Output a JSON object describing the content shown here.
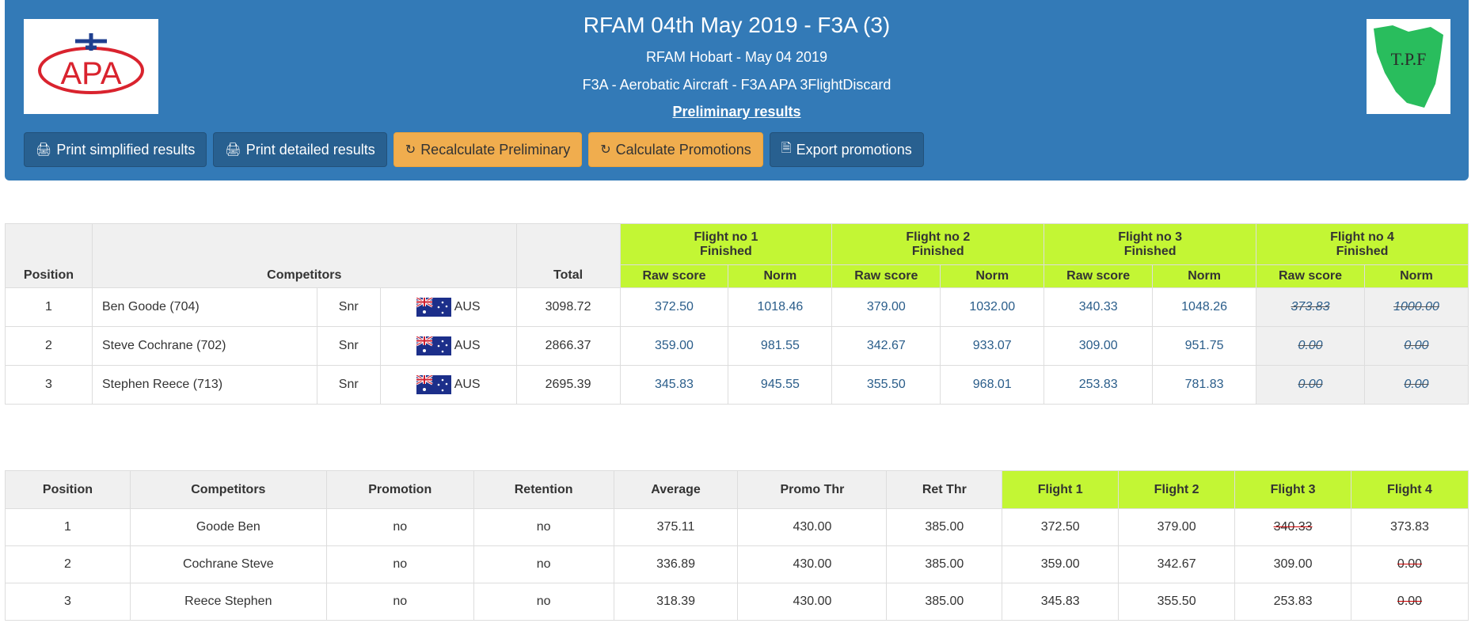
{
  "header": {
    "title": "RFAM 04th May 2019 - F3A (3)",
    "subtitle": "RFAM Hobart - May 04 2019",
    "class_line": "F3A - Aerobatic Aircraft - F3A APA 3FlightDiscard",
    "status": "Preliminary results",
    "logo_left_text": "APA",
    "logo_right_text": "T.P.F",
    "colors": {
      "bar": "#337ab7",
      "button_dark": "#286090",
      "button_warn": "#f0ad4e",
      "flight_header": "#c3f634"
    }
  },
  "buttons": [
    {
      "label": "Print simplified results",
      "icon": "print-icon",
      "style": "dark"
    },
    {
      "label": "Print detailed results",
      "icon": "print-icon",
      "style": "dark"
    },
    {
      "label": "Recalculate Preliminary",
      "icon": "refresh-icon",
      "style": "warn"
    },
    {
      "label": "Calculate Promotions",
      "icon": "refresh-icon",
      "style": "warn"
    },
    {
      "label": "Export promotions",
      "icon": "excel-file-icon",
      "style": "dark"
    }
  ],
  "results": {
    "headers": {
      "position": "Position",
      "competitors": "Competitors",
      "total": "Total",
      "flights": [
        {
          "title": "Flight no 1",
          "status": "Finished"
        },
        {
          "title": "Flight no 2",
          "status": "Finished"
        },
        {
          "title": "Flight no 3",
          "status": "Finished"
        },
        {
          "title": "Flight no 4",
          "status": "Finished"
        }
      ],
      "raw": "Raw score",
      "norm": "Norm"
    },
    "rows": [
      {
        "position": "1",
        "name": "Ben Goode (704)",
        "class": "Snr",
        "country": "AUS",
        "total": "3098.72",
        "scores": [
          [
            "372.50",
            "1018.46"
          ],
          [
            "379.00",
            "1032.00"
          ],
          [
            "340.33",
            "1048.26"
          ],
          [
            "373.83",
            "1000.00"
          ]
        ]
      },
      {
        "position": "2",
        "name": "Steve Cochrane (702)",
        "class": "Snr",
        "country": "AUS",
        "total": "2866.37",
        "scores": [
          [
            "359.00",
            "981.55"
          ],
          [
            "342.67",
            "933.07"
          ],
          [
            "309.00",
            "951.75"
          ],
          [
            "0.00",
            "0.00"
          ]
        ]
      },
      {
        "position": "3",
        "name": "Stephen Reece (713)",
        "class": "Snr",
        "country": "AUS",
        "total": "2695.39",
        "scores": [
          [
            "345.83",
            "945.55"
          ],
          [
            "355.50",
            "968.01"
          ],
          [
            "253.83",
            "781.83"
          ],
          [
            "0.00",
            "0.00"
          ]
        ]
      }
    ]
  },
  "promotions": {
    "headers": [
      "Position",
      "Competitors",
      "Promotion",
      "Retention",
      "Average",
      "Promo Thr",
      "Ret Thr",
      "Flight 1",
      "Flight 2",
      "Flight 3",
      "Flight 4"
    ],
    "rows": [
      {
        "cells": [
          "1",
          "Goode Ben",
          "no",
          "no",
          "375.11",
          "430.00",
          "385.00",
          "372.50",
          "379.00",
          "340.33",
          "373.83"
        ],
        "struck": [
          9
        ]
      },
      {
        "cells": [
          "2",
          "Cochrane Steve",
          "no",
          "no",
          "336.89",
          "430.00",
          "385.00",
          "359.00",
          "342.67",
          "309.00",
          "0.00"
        ],
        "struck": [
          10
        ]
      },
      {
        "cells": [
          "3",
          "Reece Stephen",
          "no",
          "no",
          "318.39",
          "430.00",
          "385.00",
          "345.83",
          "355.50",
          "253.83",
          "0.00"
        ],
        "struck": [
          10
        ]
      }
    ]
  }
}
